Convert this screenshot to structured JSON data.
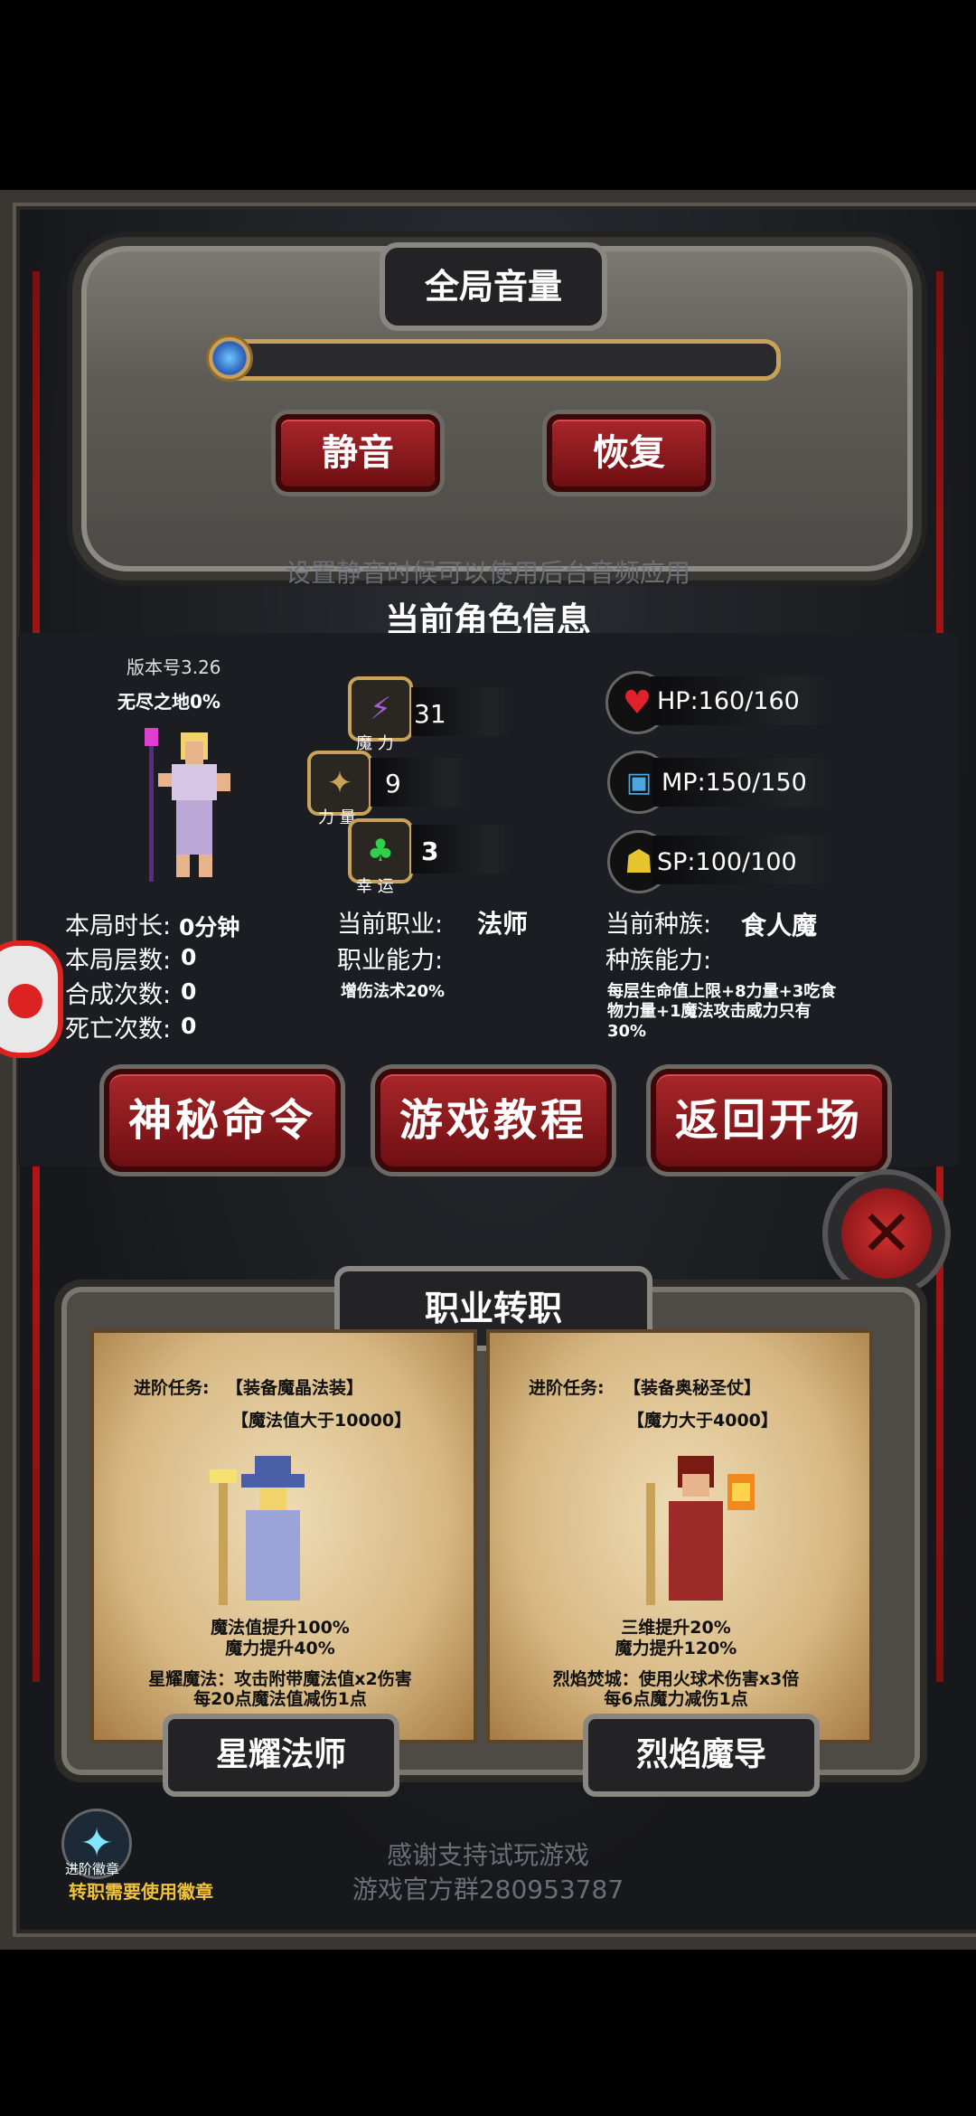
{
  "volume": {
    "title": "全局音量",
    "mute_label": "静音",
    "restore_label": "恢复",
    "mute_note": "设置静音时候可以使用后台音频应用"
  },
  "info": {
    "title": "当前角色信息",
    "version": "版本号3.26",
    "endless": "无尽之地0%",
    "stats": {
      "magic": {
        "label": "魔 力",
        "value": "31"
      },
      "strength": {
        "label": "力 量",
        "value": "9"
      },
      "luck": {
        "label": "幸 运",
        "value": "3"
      }
    },
    "hp": "HP:160/160",
    "mp": "MP:150/150",
    "sp": "SP:100/100",
    "run_time_label": "本局时长:",
    "run_time_value": "0分钟",
    "floors_label": "本局层数:",
    "floors_value": "0",
    "merge_label": "合成次数:",
    "merge_value": "0",
    "death_label": "死亡次数:",
    "death_value": "0",
    "job_label": "当前职业:",
    "job_value": "法师",
    "job_ability_label": "职业能力:",
    "job_ability_value": "增伤法术20%",
    "race_label": "当前种族:",
    "race_value": "食人魔",
    "race_ability_label": "种族能力:",
    "race_ability_value": "每层生命值上限+8力量+3吃食物力量+1魔法攻击威力只有30%"
  },
  "buttons": {
    "secret": "神秘命令",
    "tutorial": "游戏教程",
    "back": "返回开场"
  },
  "class_change": {
    "title": "职业转职",
    "left": {
      "quest_label": "进阶任务:",
      "quest1": "【装备魔晶法装】",
      "quest2": "【魔法值大于10000】",
      "bonus1": "魔法值提升100%",
      "bonus2": "魔力提升40%",
      "skill1": "星耀魔法：攻击附带魔法值x2伤害",
      "skill2": "每20点魔法值减伤1点",
      "name": "星耀法师"
    },
    "right": {
      "quest_label": "进阶任务:",
      "quest1": "【装备奥秘圣仗】",
      "quest2": "【魔力大于4000】",
      "bonus1": "三维提升20%",
      "bonus2": "魔力提升120%",
      "skill1": "烈焰焚城：使用火球术伤害x3倍",
      "skill2": "每6点魔力减伤1点",
      "name": "烈焰魔导"
    },
    "badge_label": "进阶徽章",
    "badge_note": "转职需要使用徽章"
  },
  "footer": {
    "line1": "感谢支持试玩游戏",
    "line2": "游戏官方群280953787"
  },
  "colors": {
    "button_red": "#a8262a",
    "frame_gold": "#c9a25a",
    "background": "#1f2024"
  }
}
